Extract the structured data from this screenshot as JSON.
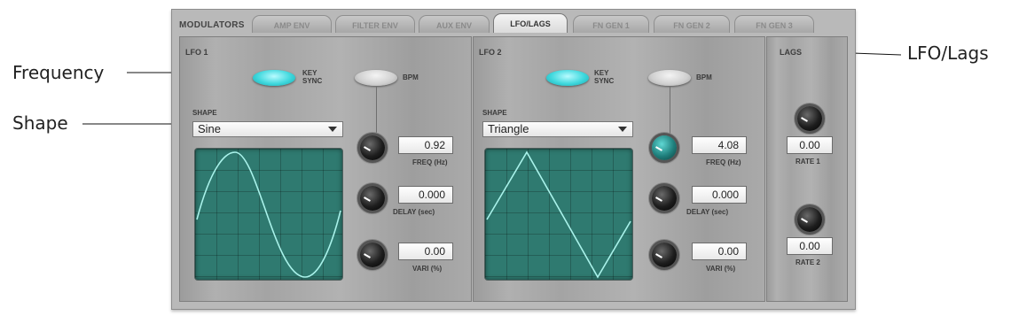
{
  "callouts": {
    "frequency": "Frequency",
    "shape": "Shape",
    "lfo_lags": "LFO/Lags"
  },
  "panel": {
    "title": "MODULATORS",
    "tabs": [
      {
        "label": "AMP ENV",
        "active": false
      },
      {
        "label": "FILTER ENV",
        "active": false
      },
      {
        "label": "AUX ENV",
        "active": false
      },
      {
        "label": "LFO/LAGS",
        "active": true
      },
      {
        "label": "FN GEN 1",
        "active": false
      },
      {
        "label": "FN GEN 2",
        "active": false
      },
      {
        "label": "FN GEN 3",
        "active": false
      }
    ]
  },
  "lfo1": {
    "title": "LFO 1",
    "key_sync_label": "KEY\nSYNC",
    "key_sync_on": true,
    "bpm_label": "BPM",
    "bpm_on": false,
    "shape_label": "SHAPE",
    "shape_value": "Sine",
    "freq_value": "0.92",
    "freq_label": "FREQ (Hz)",
    "delay_value": "0.000",
    "delay_label": "DELAY (sec)",
    "vari_value": "0.00",
    "vari_label": "VARI (%)"
  },
  "lfo2": {
    "title": "LFO 2",
    "key_sync_label": "KEY\nSYNC",
    "key_sync_on": true,
    "bpm_label": "BPM",
    "bpm_on": false,
    "shape_label": "SHAPE",
    "shape_value": "Triangle",
    "freq_value": "4.08",
    "freq_label": "FREQ (Hz)",
    "delay_value": "0.000",
    "delay_label": "DELAY (sec)",
    "vari_value": "0.00",
    "vari_label": "VARI (%)"
  },
  "lags": {
    "title": "LAGS",
    "rate1_value": "0.00",
    "rate1_label": "RATE 1",
    "rate2_value": "0.00",
    "rate2_label": "RATE 2"
  },
  "colors": {
    "key_sync_on": "#3fd8dd",
    "scope_bg": "#2f7a70",
    "scope_wave": "#a9f2ea"
  }
}
